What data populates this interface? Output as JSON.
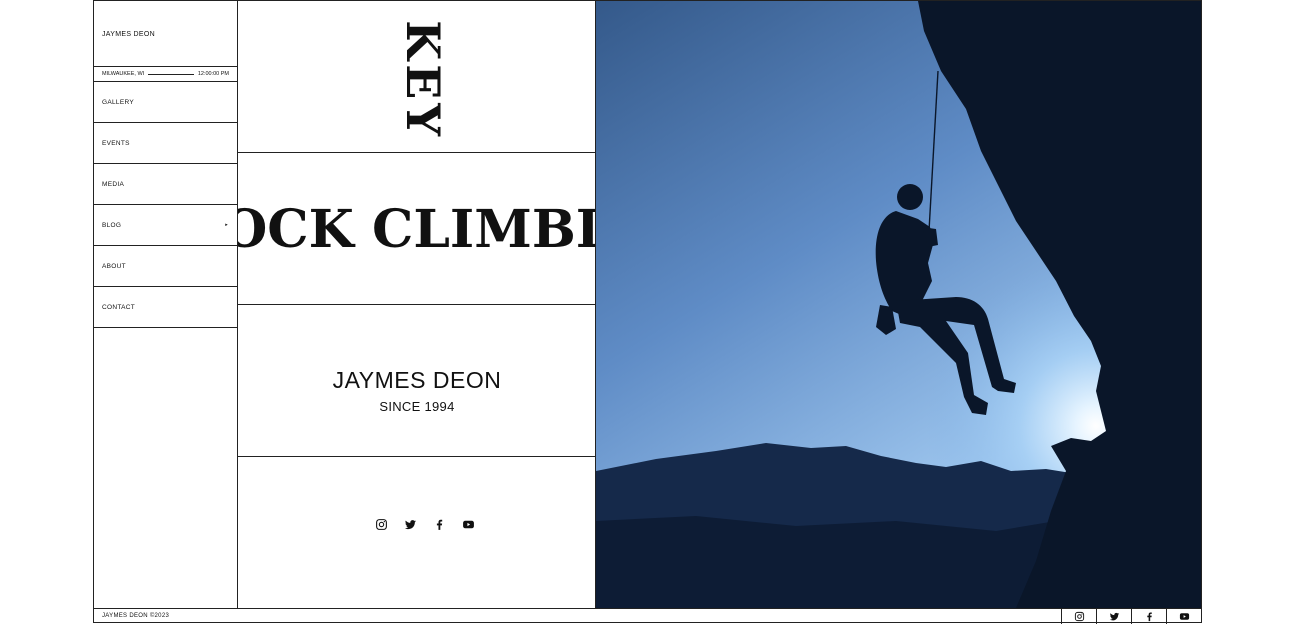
{
  "sidebar": {
    "brand": "JAYMES DEON",
    "location": "MILWAUKEE, WI",
    "time": "12:00:00 PM",
    "items": [
      {
        "label": "GALLERY"
      },
      {
        "label": "EVENTS"
      },
      {
        "label": "MEDIA"
      },
      {
        "label": "BLOG",
        "arrow": "▸"
      },
      {
        "label": "ABOUT"
      },
      {
        "label": "CONTACT"
      }
    ]
  },
  "center": {
    "vertical_word": "S KEY",
    "marquee_text": "OCK CLIMBIN",
    "name": "JAYMES DEON",
    "since": "SINCE 1994",
    "socials": [
      "instagram-icon",
      "twitter-icon",
      "facebook-icon",
      "youtube-icon"
    ]
  },
  "footer": {
    "copyright": "JAYMES DEON ©2023",
    "socials": [
      "instagram-icon",
      "twitter-icon",
      "facebook-icon",
      "youtube-icon"
    ]
  },
  "colors": {
    "border": "#222222",
    "sky_top": "#3f6494",
    "sky_glow": "#cfe6ff",
    "silhouette": "#0d1e36"
  }
}
